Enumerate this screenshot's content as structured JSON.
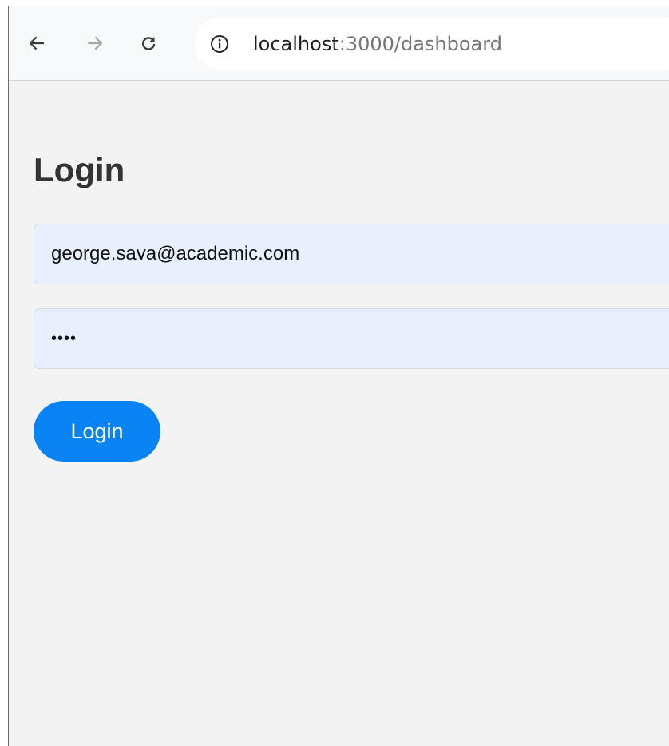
{
  "browser": {
    "url_host": "localhost",
    "url_rest": ":3000/dashboard",
    "icons": {
      "back": "arrow-left-icon",
      "forward": "arrow-right-icon",
      "reload": "reload-icon",
      "site_info": "info-circle-icon"
    }
  },
  "page": {
    "title": "Login",
    "email_value": "george.sava@academic.com",
    "password_value": "••••",
    "login_button_label": "Login"
  },
  "colors": {
    "accent": "#0a84f5",
    "input_bg": "#e8f0fe",
    "page_bg": "#f3f3f3"
  }
}
